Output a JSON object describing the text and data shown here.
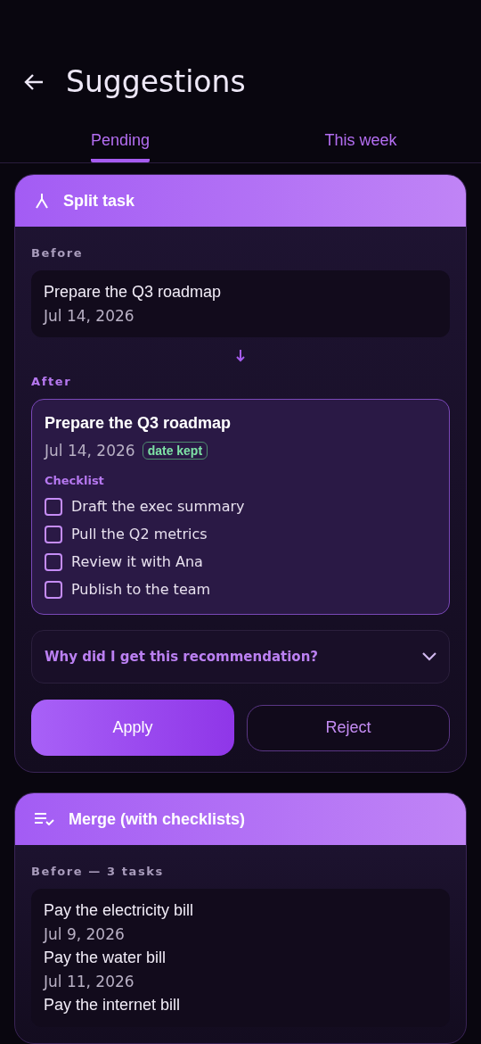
{
  "header": {
    "title": "Suggestions"
  },
  "tabs": [
    {
      "label": "Pending",
      "selected": true
    },
    {
      "label": "This week",
      "selected": false
    }
  ],
  "cards": [
    {
      "kind": "split",
      "title": "Split task",
      "before_label": "Before",
      "before": [
        {
          "title": "Prepare the Q3 roadmap",
          "date": "Jul 14, 2026"
        }
      ],
      "after_label": "After",
      "after": {
        "title": "Prepare the Q3 roadmap",
        "date": "Jul 14, 2026",
        "badge": "date kept",
        "checklist_label": "Checklist",
        "checklist": [
          {
            "label": "Draft the exec summary",
            "checked": false
          },
          {
            "label": "Pull the Q2 metrics",
            "checked": false
          },
          {
            "label": "Review it with Ana",
            "checked": false
          },
          {
            "label": "Publish to the team",
            "checked": false
          }
        ]
      },
      "why": {
        "label": "Why did I get this recommendation?",
        "expanded": false
      },
      "buttons": [
        "Apply",
        "Reject"
      ]
    },
    {
      "kind": "merge",
      "title": "Merge (with checklists)",
      "before_label": "Before — 3 tasks",
      "before": [
        {
          "title": "Pay the electricity bill",
          "date": "Jul 9, 2026"
        },
        {
          "title": "Pay the water bill",
          "date": "Jul 11, 2026"
        },
        {
          "title": "Pay the internet bill"
        }
      ]
    }
  ]
}
